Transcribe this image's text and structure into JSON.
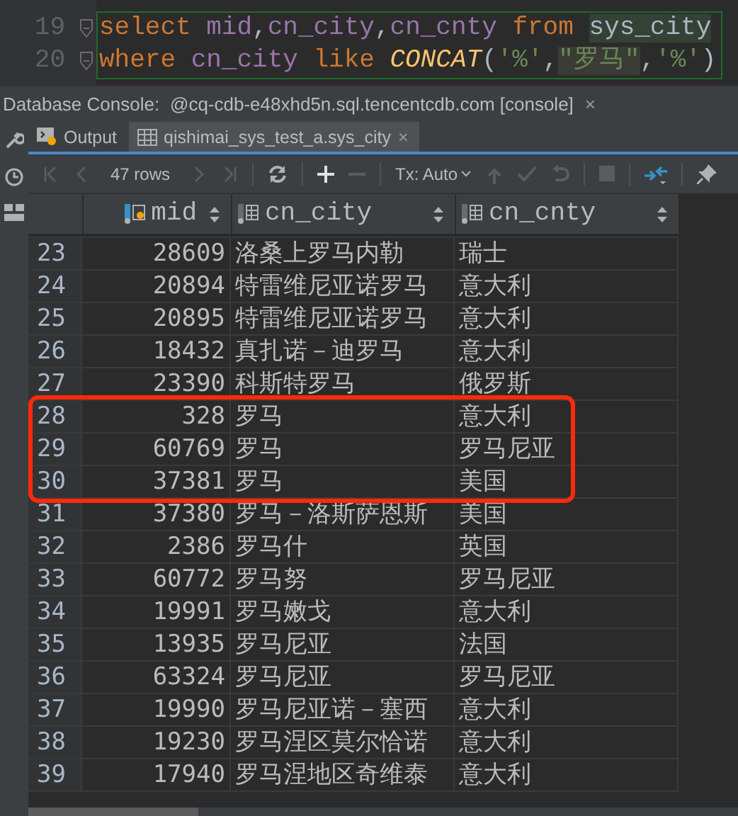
{
  "editor": {
    "lines": [
      {
        "number": "19",
        "tokens": [
          {
            "text": "select ",
            "kind": "keyword"
          },
          {
            "text": "mid",
            "kind": "column"
          },
          {
            "text": ",",
            "kind": "punct"
          },
          {
            "text": "cn_city",
            "kind": "column"
          },
          {
            "text": ",",
            "kind": "punct"
          },
          {
            "text": "cn_cnty ",
            "kind": "column"
          },
          {
            "text": "from ",
            "kind": "keyword"
          },
          {
            "text": "sys_city",
            "kind": "table",
            "highlighted": true
          }
        ]
      },
      {
        "number": "20",
        "tokens": [
          {
            "text": "where ",
            "kind": "keyword"
          },
          {
            "text": "cn_city ",
            "kind": "column"
          },
          {
            "text": "like ",
            "kind": "keyword"
          },
          {
            "text": "CONCAT",
            "kind": "function"
          },
          {
            "text": "(",
            "kind": "punct"
          },
          {
            "text": "'%'",
            "kind": "string"
          },
          {
            "text": ",",
            "kind": "punct"
          },
          {
            "text": "\"罗马\"",
            "kind": "string",
            "highlighted": true
          },
          {
            "text": ",",
            "kind": "punct"
          },
          {
            "text": "'%'",
            "kind": "string"
          },
          {
            "text": ")",
            "kind": "punct"
          }
        ]
      }
    ]
  },
  "console": {
    "label": "Database Console:",
    "tab": "@cq-cdb-e48xhd5n.sql.tencentcdb.com [console]",
    "close": "×"
  },
  "tabs": [
    {
      "label": "Output",
      "kind": "output",
      "selected": false
    },
    {
      "label": "qishimai_sys_test_a.sys_city",
      "kind": "table",
      "selected": true,
      "close": "×"
    }
  ],
  "toolbar": {
    "rows": "47 rows",
    "tx": "Tx: Auto"
  },
  "table": {
    "columns": [
      {
        "name": "mid",
        "kind": "key"
      },
      {
        "name": "cn_city",
        "kind": "column"
      },
      {
        "name": "cn_cnty",
        "kind": "column"
      }
    ],
    "rows": [
      {
        "num": "23",
        "mid": "28609",
        "city": "洛桑上罗马内勒",
        "cnty": "瑞士",
        "marked": false
      },
      {
        "num": "24",
        "mid": "20894",
        "city": "特雷维尼亚诺罗马",
        "cnty": "意大利",
        "marked": false
      },
      {
        "num": "25",
        "mid": "20895",
        "city": "特雷维尼亚诺罗马",
        "cnty": "意大利",
        "marked": false
      },
      {
        "num": "26",
        "mid": "18432",
        "city": "真扎诺－迪罗马",
        "cnty": "意大利",
        "marked": false
      },
      {
        "num": "27",
        "mid": "23390",
        "city": "科斯特罗马",
        "cnty": "俄罗斯",
        "marked": false
      },
      {
        "num": "28",
        "mid": "328",
        "city": "罗马",
        "cnty": "意大利",
        "marked": true
      },
      {
        "num": "29",
        "mid": "60769",
        "city": "罗马",
        "cnty": "罗马尼亚",
        "marked": true
      },
      {
        "num": "30",
        "mid": "37381",
        "city": "罗马",
        "cnty": "美国",
        "marked": true
      },
      {
        "num": "31",
        "mid": "37380",
        "city": "罗马－洛斯萨恩斯",
        "cnty": "美国",
        "marked": false
      },
      {
        "num": "32",
        "mid": "2386",
        "city": "罗马什",
        "cnty": "英国",
        "marked": false
      },
      {
        "num": "33",
        "mid": "60772",
        "city": "罗马努",
        "cnty": "罗马尼亚",
        "marked": false
      },
      {
        "num": "34",
        "mid": "19991",
        "city": "罗马嫩戈",
        "cnty": "意大利",
        "marked": false
      },
      {
        "num": "35",
        "mid": "13935",
        "city": "罗马尼亚",
        "cnty": "法国",
        "marked": false
      },
      {
        "num": "36",
        "mid": "63324",
        "city": "罗马尼亚",
        "cnty": "罗马尼亚",
        "marked": false
      },
      {
        "num": "37",
        "mid": "19990",
        "city": "罗马尼亚诺－塞西",
        "cnty": "意大利",
        "marked": false
      },
      {
        "num": "38",
        "mid": "19230",
        "city": "罗马涅区莫尔恰诺",
        "cnty": "意大利",
        "marked": false
      },
      {
        "num": "39",
        "mid": "17940",
        "city": "罗马涅地区奇维泰",
        "cnty": "意大利",
        "marked": false
      }
    ]
  }
}
